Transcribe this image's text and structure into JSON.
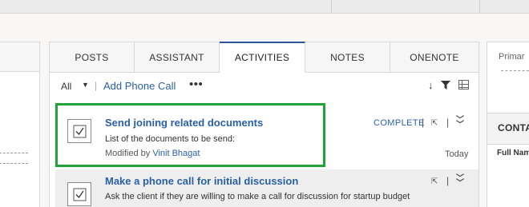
{
  "tabs": [
    {
      "label": "POSTS"
    },
    {
      "label": "ASSISTANT"
    },
    {
      "label": "ACTIVITIES"
    },
    {
      "label": "NOTES"
    },
    {
      "label": "ONENOTE"
    }
  ],
  "toolbar": {
    "filter_label": "All",
    "add_phone_call": "Add Phone Call",
    "more": "•••"
  },
  "activities": [
    {
      "title": "Send joining related documents",
      "description": "List of the documents to be send:",
      "modified_by_label": "Modified by",
      "modified_by": "Vinit Bhagat",
      "date": "Today",
      "complete_label": "COMPLETE"
    },
    {
      "title": "Make a phone call for initial discussion",
      "description": "Ask the client if they are willing to make a call for discussion for startup budget"
    }
  ],
  "right_panel": {
    "primary": "Primar",
    "section": "CONTA",
    "column": "Full Nam"
  },
  "colors": {
    "link": "#2b5fa5",
    "highlight": "#22a33a",
    "active_tab": "#2b579a"
  }
}
